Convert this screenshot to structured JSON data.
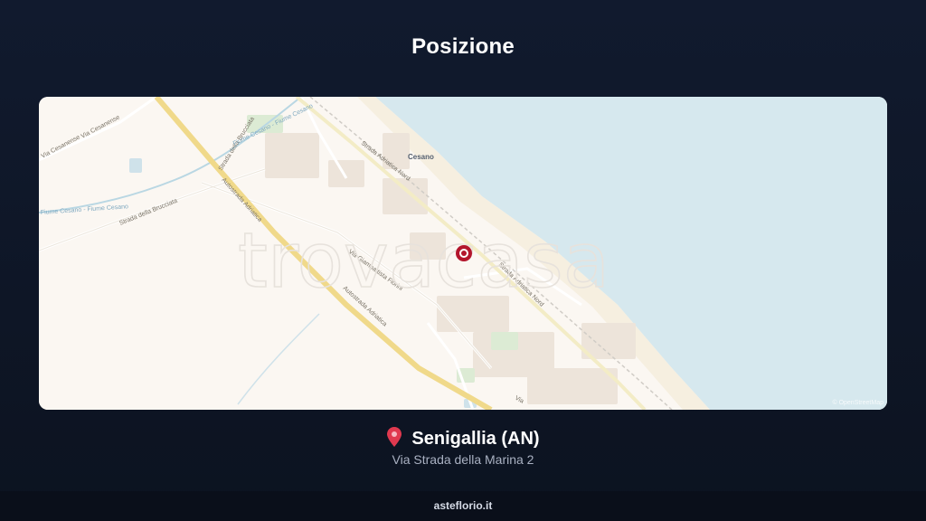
{
  "page": {
    "title": "Posizione"
  },
  "map": {
    "watermark": "trovacasa",
    "credit": "© OpenStreetMap",
    "place_labels": {
      "town": "Cesano",
      "via_cesanense_1": "Via Cesanense",
      "via_cesanense_2": "Via Cesanense",
      "strada_brucciata_1": "Strada della Brucciata",
      "strada_brucciata_2": "Strada della Brucciata",
      "fiume_cesano_top": "Fiume Cesano - Fiume Cesano",
      "fiume_cesano_left": "Fiume Cesano - Fiume Cesano",
      "autostrada_1": "Autostrada Adriatica",
      "autostrada_2": "Autostrada Adriatica",
      "strada_adriatica_nord_1": "Strada Adriatica Nord",
      "strada_adriatica_nord_2": "Strada Adriatica Nord",
      "via_fiorini": "Via Giambattista Fiorini",
      "via_bottom": "Via"
    },
    "colors": {
      "land": "#fbf7f2",
      "sea": "#d6e8ee",
      "motorway": "#f0d98a",
      "marker": "#b3152c"
    }
  },
  "location": {
    "pin_icon": "map-pin-icon",
    "city": "Senigallia (AN)",
    "address": "Via Strada della Marina 2"
  },
  "footer": {
    "site": "asteflorio.it"
  }
}
